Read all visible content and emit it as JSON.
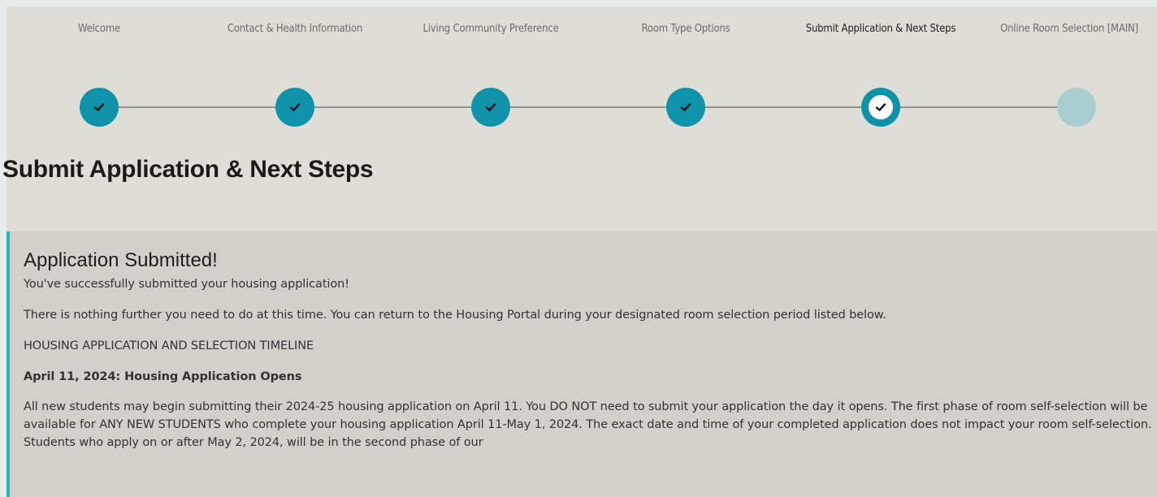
{
  "stepper": {
    "steps": [
      {
        "label": "Welcome",
        "state": "complete"
      },
      {
        "label": "Contact & Health Information",
        "state": "complete"
      },
      {
        "label": "Living Community Preference",
        "state": "complete"
      },
      {
        "label": "Room Type Options",
        "state": "complete"
      },
      {
        "label": "Submit Application & Next Steps",
        "state": "current"
      },
      {
        "label": "Online Room Selection [MAIN]",
        "state": "future"
      }
    ]
  },
  "page": {
    "title": "Submit Application & Next Steps"
  },
  "panel": {
    "heading": "Application Submitted!",
    "success_text": "You've successfully submitted your housing application!",
    "info_text": "There is nothing further you need to do at this time. You can return to the Housing Portal during your designated room selection period listed below.",
    "timeline_heading": "HOUSING APPLICATION AND SELECTION TIMELINE",
    "timeline_item_title": "April 11, 2024: Housing Application Opens",
    "timeline_item_body": "All new students may begin submitting their 2024-25 housing application on April 11. You DO NOT need to submit your application the day it opens. The first phase of room self-selection will be available for ANY NEW STUDENTS who complete your housing application April 11-May 1, 2024. The exact date and time of your completed application does not impact your room self-selection. Students who apply on or after May 2, 2024, will be in the second phase of our"
  },
  "colors": {
    "accent": "#0e93ab",
    "future_step": "#a9ced0",
    "panel_border": "#22b5c8",
    "panel_bg": "#d3cfcb",
    "page_bg": "#dfded6"
  },
  "icons": {
    "step_complete": "check-icon"
  }
}
